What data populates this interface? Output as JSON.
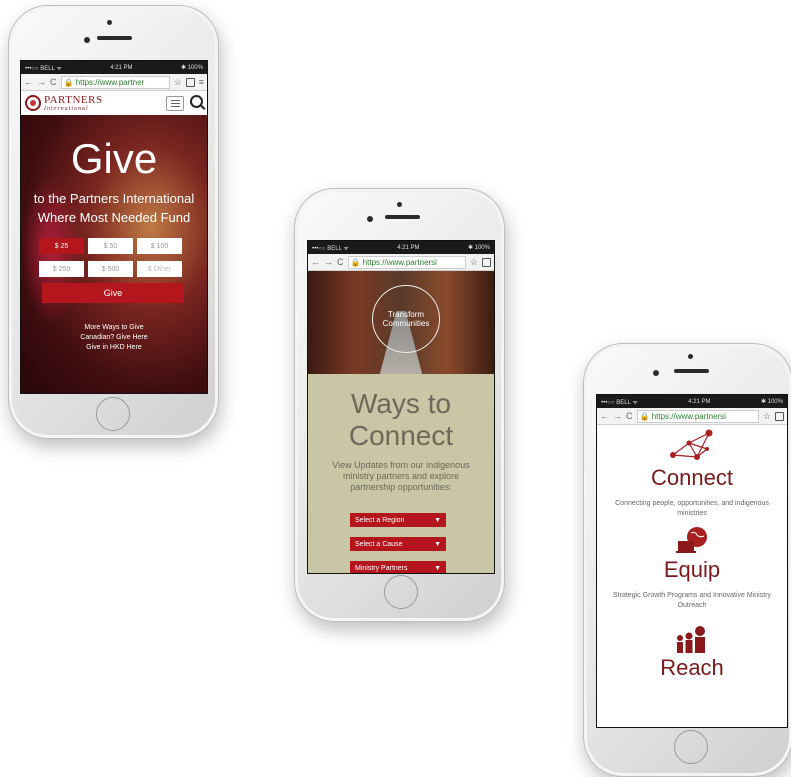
{
  "status_bar": {
    "carrier": "•••○○ BELL ᯤ",
    "time": "4:21 PM",
    "battery": "✱ 100%"
  },
  "phone1": {
    "url": "https://www.partner",
    "logo_main": "PARTNERS",
    "logo_sub": "International",
    "hero_title": "Give",
    "hero_sub_line1": "to the Partners International",
    "hero_sub_line2": "Where Most Needed Fund",
    "amounts": [
      "$ 25",
      "$ 50",
      "$ 100",
      "$ 250",
      "$ 500",
      "$ Other"
    ],
    "selected_amount": "$ 25",
    "give_label": "Give",
    "link1": "More Ways to Give",
    "link2": "Canadian? Give Here",
    "link3": "Give in HKD Here"
  },
  "phone2": {
    "url": "https://www.partnersi",
    "circle_line1": "Transform",
    "circle_line2": "Communities",
    "heading_line1": "Ways to",
    "heading_line2": "Connect",
    "desc_line1": "View Updates from our indigenous",
    "desc_line2": "ministry partners and explore",
    "desc_line3": "partnership opportunities:",
    "select_region": "Select a Region",
    "select_cause": "Select a Cause",
    "select_partners": "Ministry Partners"
  },
  "phone3": {
    "url": "https://www.partnersi",
    "connect_title": "Connect",
    "connect_desc_line1": "Connecting people, opportunities, and indigenous",
    "connect_desc_line2": "ministries",
    "equip_title": "Equip",
    "equip_desc_line1": "Strategic Growth Programs and Innovative Ministry",
    "equip_desc_line2": "Outreach",
    "reach_title": "Reach"
  },
  "colors": {
    "brand_red": "#b5161d",
    "title_maroon": "#7a1a1a",
    "beige": "#c8c6a4"
  },
  "icons": [
    "back-arrow-icon",
    "forward-arrow-icon",
    "reload-icon",
    "lock-icon",
    "star-icon",
    "tabs-icon",
    "menu-icon",
    "search-icon",
    "chevron-down-icon",
    "network-icon",
    "globe-laptop-icon",
    "people-icon"
  ]
}
